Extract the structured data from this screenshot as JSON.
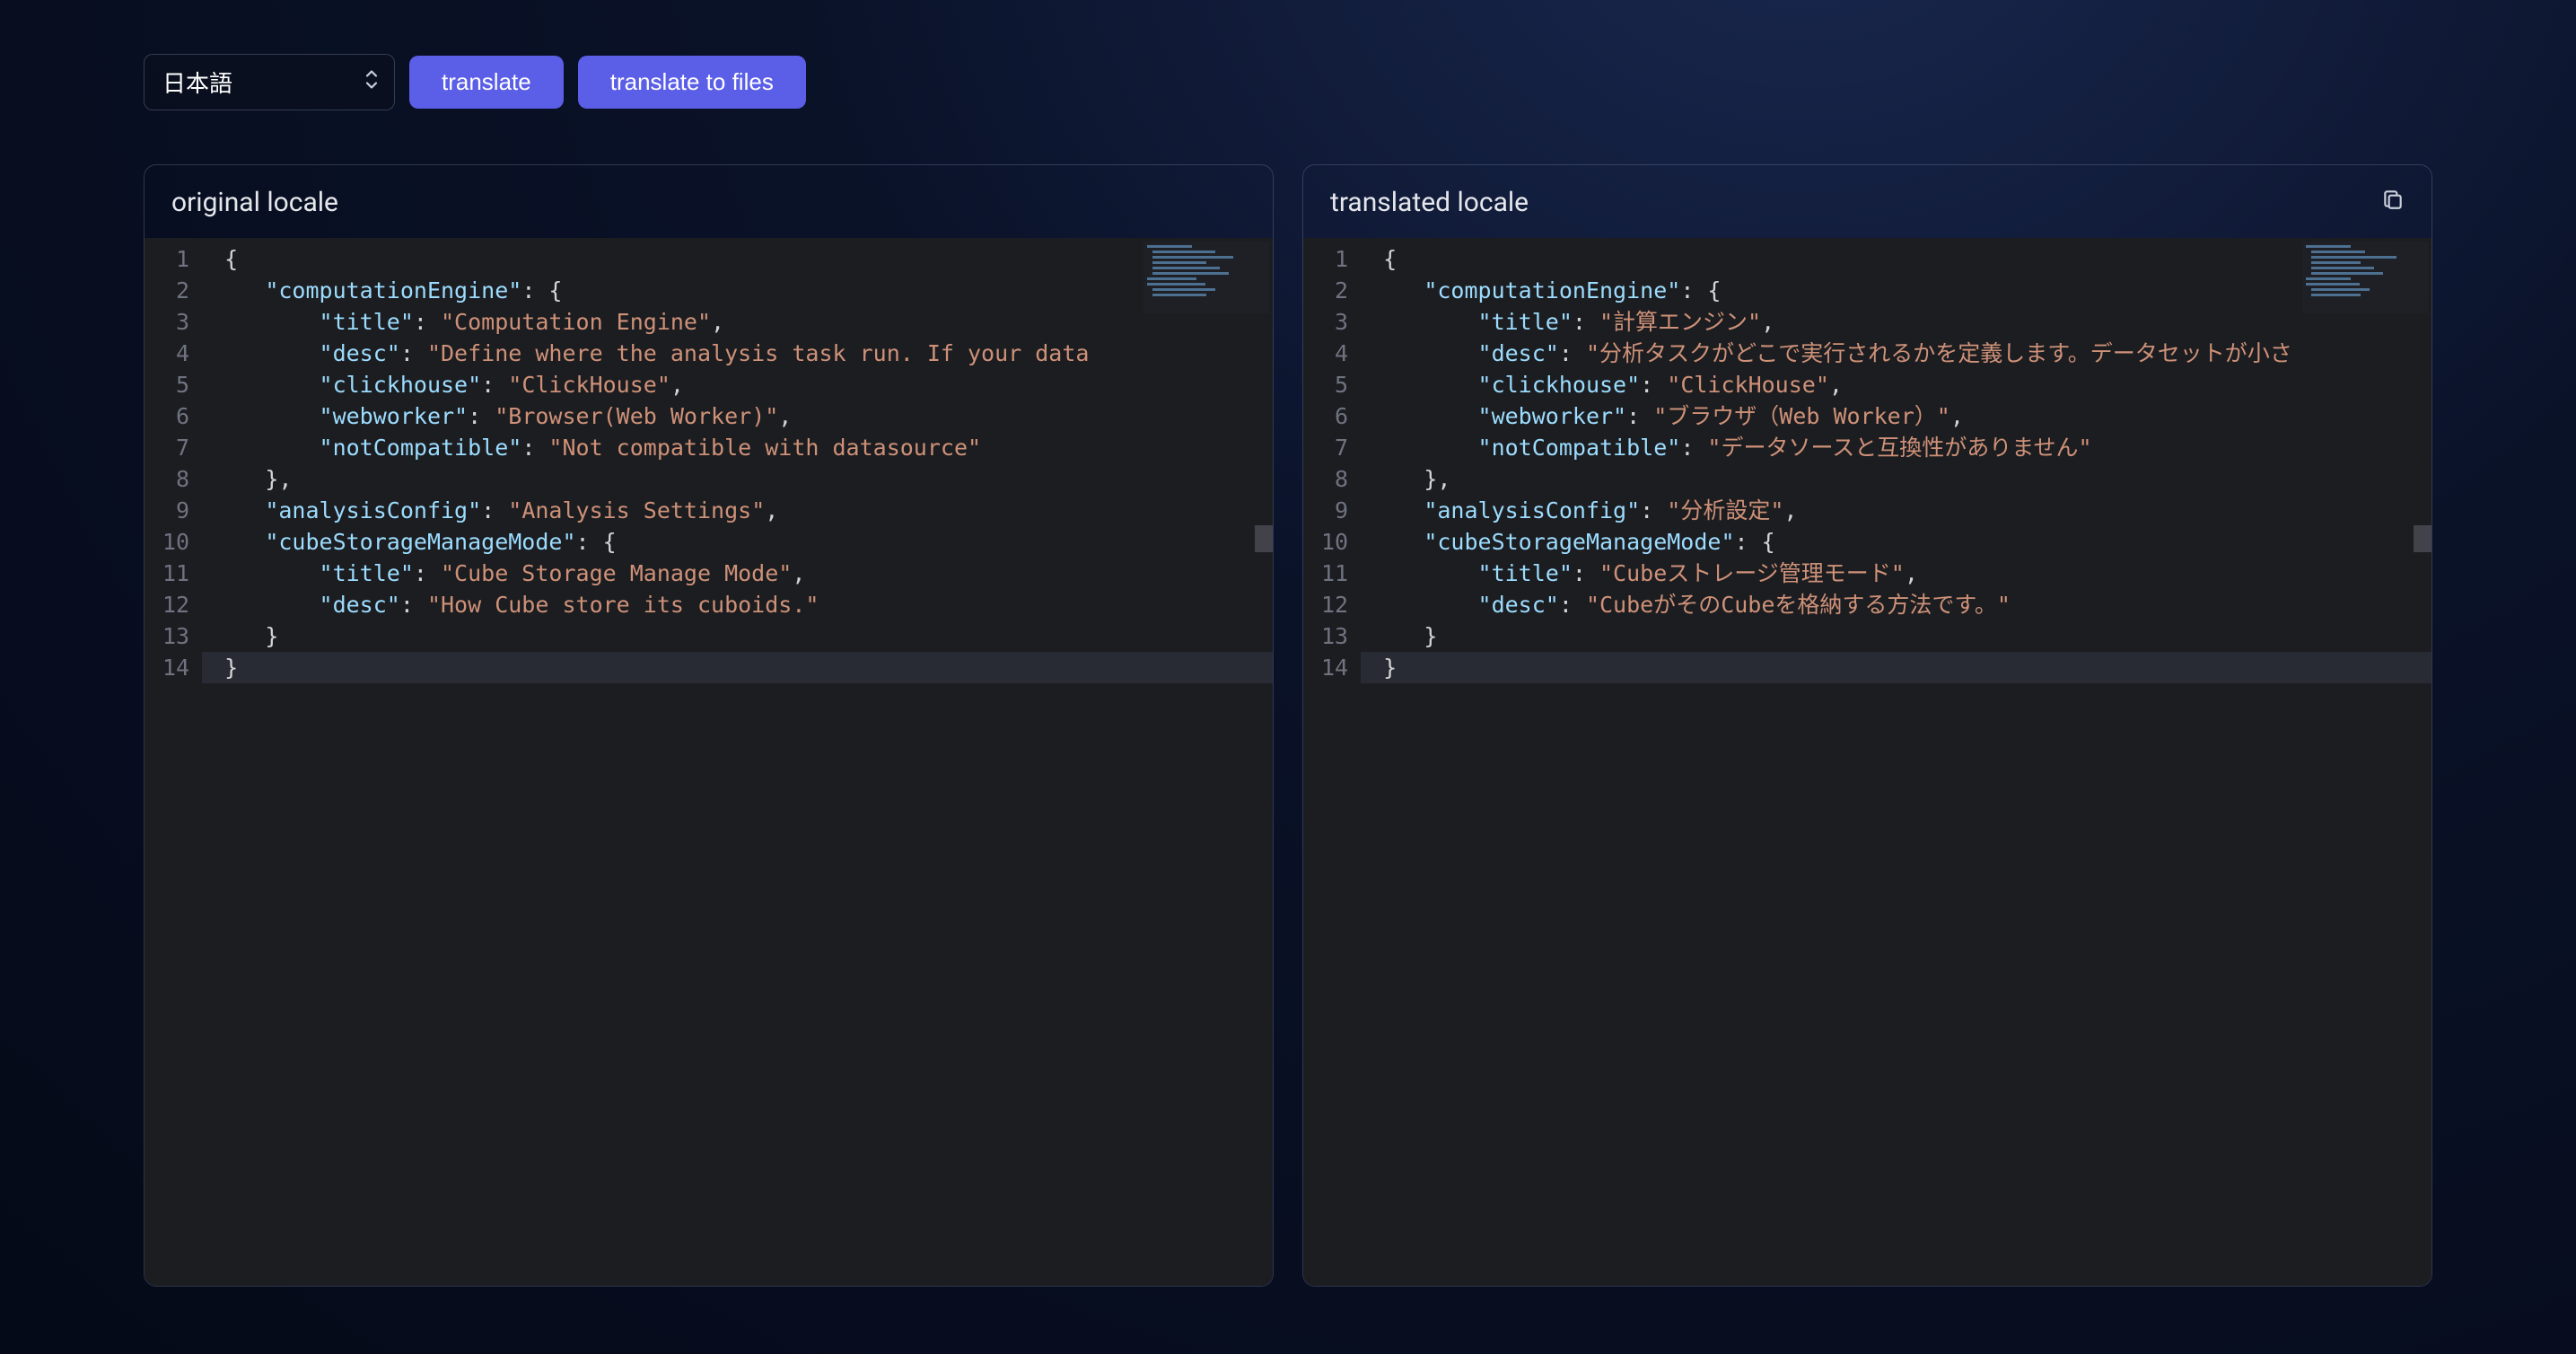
{
  "toolbar": {
    "language_selected": "日本語",
    "translate_label": "translate",
    "translate_files_label": "translate to files"
  },
  "panels": {
    "original_title": "original locale",
    "translated_title": "translated locale"
  },
  "line_numbers": [
    1,
    2,
    3,
    4,
    5,
    6,
    7,
    8,
    9,
    10,
    11,
    12,
    13,
    14
  ],
  "colors": {
    "accent": "#5b5ee6",
    "editor_bg": "#1c1d21",
    "key": "#9cdcfe",
    "string": "#ce9178"
  },
  "original_json": {
    "computationEngine": {
      "title": "Computation Engine",
      "desc": "Define where the analysis task run. If your data",
      "clickhouse": "ClickHouse",
      "webworker": "Browser(Web Worker)",
      "notCompatible": "Not compatible with datasource"
    },
    "analysisConfig": "Analysis Settings",
    "cubeStorageManageMode": {
      "title": "Cube Storage Manage Mode",
      "desc": "How Cube store its cuboids."
    }
  },
  "translated_json": {
    "computationEngine": {
      "title": "計算エンジン",
      "desc": "分析タスクがどこで実行されるかを定義します。データセットが小さ",
      "clickhouse": "ClickHouse",
      "webworker": "ブラウザ（Web Worker）",
      "notCompatible": "データソースと互換性がありません"
    },
    "analysisConfig": "分析設定",
    "cubeStorageManageMode": {
      "title": "Cubeストレージ管理モード",
      "desc": "CubeがそのCubeを格納する方法です。"
    }
  }
}
